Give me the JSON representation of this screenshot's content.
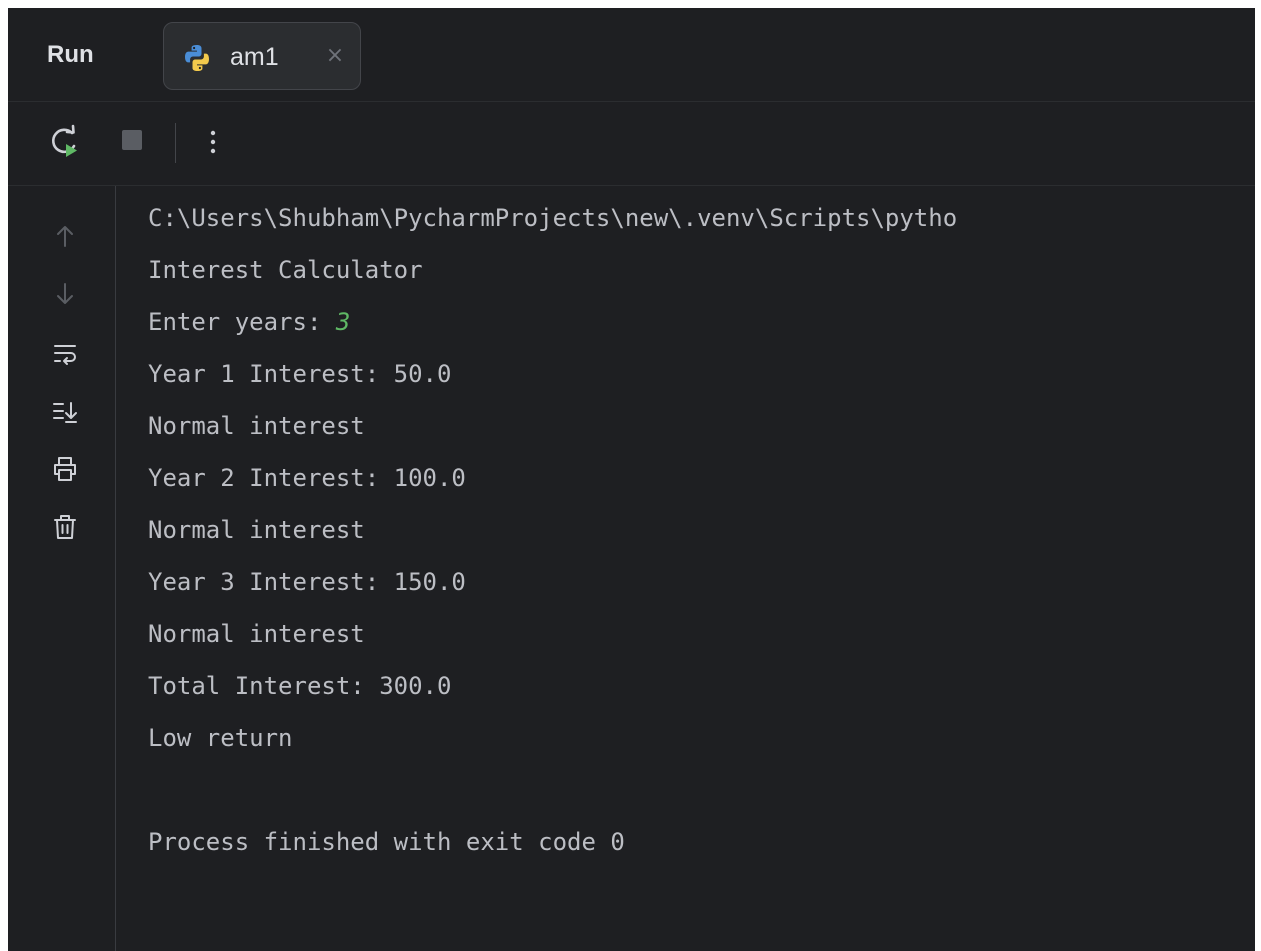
{
  "header": {
    "title": "Run",
    "tab": {
      "label": "am1",
      "close_glyph": "×",
      "icon": "python-icon"
    }
  },
  "toolbar": {
    "rerun_icon": "rerun-icon",
    "stop_icon": "stop-icon",
    "more_icon": "more-vertical-icon"
  },
  "gutter": {
    "icons": [
      "arrow-up-icon",
      "arrow-down-icon",
      "soft-wrap-icon",
      "scroll-to-end-icon",
      "print-icon",
      "trash-icon"
    ]
  },
  "console": {
    "command": "C:\\Users\\Shubham\\PycharmProjects\\new\\.venv\\Scripts\\pytho",
    "line_title": "Interest Calculator",
    "prompt": "Enter years: ",
    "input_value": "3",
    "year1": "Year 1 Interest: 50.0",
    "year1_note": "Normal interest",
    "year2": "Year 2 Interest: 100.0",
    "year2_note": "Normal interest",
    "year3": "Year 3 Interest: 150.0",
    "year3_note": "Normal interest",
    "total": "Total Interest: 300.0",
    "verdict": "Low return",
    "exit_message": "Process finished with exit code 0"
  },
  "colors": {
    "background": "#1e1f22",
    "text": "#bcbec4",
    "input": "#5fb865",
    "rerun_accent": "#5fb865"
  }
}
